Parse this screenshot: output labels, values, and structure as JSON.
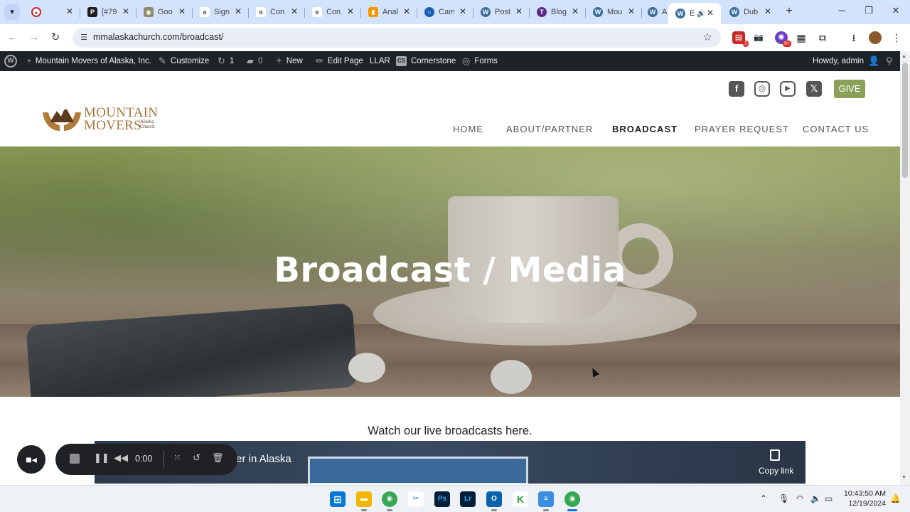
{
  "browser": {
    "tabs": [
      {
        "title": "",
        "icon": "record-dot-icon",
        "color": "#c62828"
      },
      {
        "title": "[#79",
        "icon": "p-logo-icon",
        "color": "#1f1f1f"
      },
      {
        "title": "Goo",
        "icon": "lock-icon",
        "color": "#8d8d6a"
      },
      {
        "title": "Sign",
        "icon": "bicycle-icon",
        "color": "#444444"
      },
      {
        "title": "Con",
        "icon": "bicycle-icon",
        "color": "#444444"
      },
      {
        "title": "Con",
        "icon": "bicycle-icon",
        "color": "#444444"
      },
      {
        "title": "Anal",
        "icon": "analytics-icon",
        "color": "#f29900"
      },
      {
        "title": "Cam",
        "icon": "camera-ring-icon",
        "color": "#1a5fb4"
      },
      {
        "title": "Post",
        "icon": "wordpress-icon",
        "color": "#3c6e9e"
      },
      {
        "title": "Blog",
        "icon": "t-logo-icon",
        "color": "#5b2a86"
      },
      {
        "title": "Mou",
        "icon": "wordpress-icon",
        "color": "#3c6e9e"
      },
      {
        "title": "Abo",
        "icon": "wordpress-icon",
        "color": "#3c6e9e"
      },
      {
        "title": "E",
        "icon": "wordpress-icon",
        "color": "#3c6e9e",
        "active": true
      },
      {
        "title": "Dub",
        "icon": "wordpress-icon",
        "color": "#3c6e9e"
      }
    ],
    "new_tab": "+",
    "url": "mmalaskachurch.com/broadcast/"
  },
  "admin_bar": {
    "site_name": "Mountain Movers of Alaska, Inc.",
    "customize": "Customize",
    "updates": "1",
    "comments": "0",
    "new": "New",
    "edit_page": "Edit Page",
    "llar": "LLAR",
    "cornerstone": "Cornerstone",
    "forms": "Forms",
    "howdy": "Howdy, admin"
  },
  "site": {
    "logo_line1": "MOUNTAIN",
    "logo_line2": "MOVERS",
    "logo_small1": "Alaska",
    "logo_small2": "Church",
    "give": "GIVE",
    "menu": [
      "HOME",
      "ABOUT/PARTNER",
      "BROADCAST",
      "PRAYER REQUEST",
      "CONTACT US"
    ],
    "current_menu": "BROADCAST",
    "social": [
      "facebook-icon",
      "instagram-icon",
      "youtube-icon",
      "x-icon"
    ],
    "accent": "#8ca05a"
  },
  "hero": {
    "title": "Broadcast / Media"
  },
  "content": {
    "intro": "Watch our live broadcasts here.",
    "video_title": "ter in Alaska",
    "copy_link": "Copy link"
  },
  "recorder": {
    "time": "0:00"
  },
  "taskbar": {
    "time": "10:43:50 AM",
    "date": "12/19/2024"
  }
}
